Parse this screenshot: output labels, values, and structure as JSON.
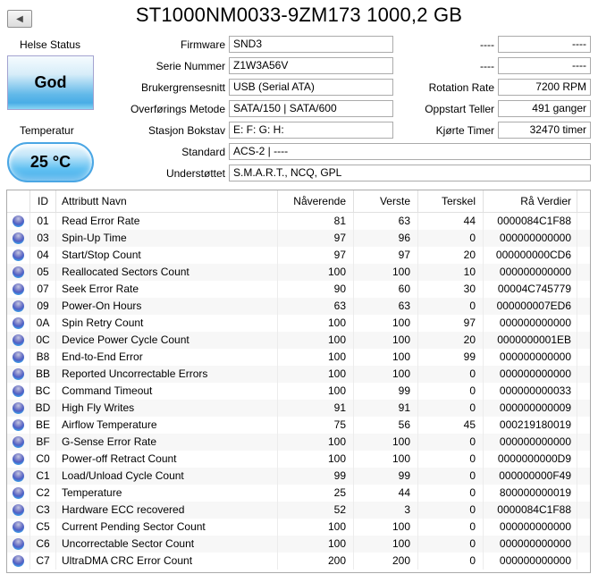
{
  "window": {
    "title": "ST1000NM0033-9ZM173 1000,2 GB"
  },
  "health": {
    "label": "Helse Status",
    "value": "God"
  },
  "temperature": {
    "label": "Temperatur",
    "value": "25 °C"
  },
  "fields_left": [
    {
      "label": "Firmware",
      "value": "SND3",
      "wide": false
    },
    {
      "label": "Serie Nummer",
      "value": "Z1W3A56V",
      "wide": false
    },
    {
      "label": "Brukergrensesnitt",
      "value": "USB (Serial ATA)",
      "wide": false
    },
    {
      "label": "Overførings Metode",
      "value": "SATA/150 | SATA/600",
      "wide": false
    },
    {
      "label": "Stasjon Bokstav",
      "value": "E: F: G: H:",
      "wide": false
    },
    {
      "label": "Standard",
      "value": "ACS-2 | ----",
      "wide": true
    },
    {
      "label": "Understøttet",
      "value": "S.M.A.R.T., NCQ, GPL",
      "wide": true
    }
  ],
  "fields_right": [
    {
      "label": "----",
      "value": "----"
    },
    {
      "label": "----",
      "value": "----"
    },
    {
      "label": "Rotation Rate",
      "value": "7200 RPM"
    },
    {
      "label": "Oppstart Teller",
      "value": "491 ganger"
    },
    {
      "label": "Kjørte Timer",
      "value": "32470 timer"
    }
  ],
  "smart_table": {
    "columns": [
      "",
      "ID",
      "Attributt Navn",
      "Nåverende",
      "Verste",
      "Terskel",
      "Rå Verdier"
    ],
    "status_icon": "blue-orb-good",
    "rows": [
      [
        "01",
        "Read Error Rate",
        "81",
        "63",
        "44",
        "0000084C1F88"
      ],
      [
        "03",
        "Spin-Up Time",
        "97",
        "96",
        "0",
        "000000000000"
      ],
      [
        "04",
        "Start/Stop Count",
        "97",
        "97",
        "20",
        "000000000CD6"
      ],
      [
        "05",
        "Reallocated Sectors Count",
        "100",
        "100",
        "10",
        "000000000000"
      ],
      [
        "07",
        "Seek Error Rate",
        "90",
        "60",
        "30",
        "00004C745779"
      ],
      [
        "09",
        "Power-On Hours",
        "63",
        "63",
        "0",
        "000000007ED6"
      ],
      [
        "0A",
        "Spin Retry Count",
        "100",
        "100",
        "97",
        "000000000000"
      ],
      [
        "0C",
        "Device Power Cycle Count",
        "100",
        "100",
        "20",
        "0000000001EB"
      ],
      [
        "B8",
        "End-to-End Error",
        "100",
        "100",
        "99",
        "000000000000"
      ],
      [
        "BB",
        "Reported Uncorrectable Errors",
        "100",
        "100",
        "0",
        "000000000000"
      ],
      [
        "BC",
        "Command Timeout",
        "100",
        "99",
        "0",
        "000000000033"
      ],
      [
        "BD",
        "High Fly Writes",
        "91",
        "91",
        "0",
        "000000000009"
      ],
      [
        "BE",
        "Airflow Temperature",
        "75",
        "56",
        "45",
        "000219180019"
      ],
      [
        "BF",
        "G-Sense Error Rate",
        "100",
        "100",
        "0",
        "000000000000"
      ],
      [
        "C0",
        "Power-off Retract Count",
        "100",
        "100",
        "0",
        "0000000000D9"
      ],
      [
        "C1",
        "Load/Unload Cycle Count",
        "99",
        "99",
        "0",
        "000000000F49"
      ],
      [
        "C2",
        "Temperature",
        "25",
        "44",
        "0",
        "800000000019"
      ],
      [
        "C3",
        "Hardware ECC recovered",
        "52",
        "3",
        "0",
        "0000084C1F88"
      ],
      [
        "C5",
        "Current Pending Sector Count",
        "100",
        "100",
        "0",
        "000000000000"
      ],
      [
        "C6",
        "Uncorrectable Sector Count",
        "100",
        "100",
        "0",
        "000000000000"
      ],
      [
        "C7",
        "UltraDMA CRC Error Count",
        "200",
        "200",
        "0",
        "000000000000"
      ]
    ]
  },
  "colors": {
    "health_good": "#4aade6",
    "temp_blue": "#3fa9e9",
    "box_border": "#ababab",
    "grid_line": "#ececec",
    "row_stripe": "#f7f7f7"
  }
}
